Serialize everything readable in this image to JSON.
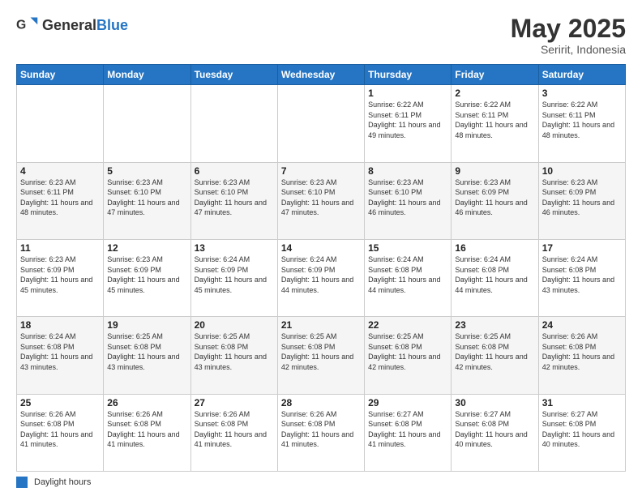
{
  "logo": {
    "general": "General",
    "blue": "Blue"
  },
  "header": {
    "title": "May 2025",
    "subtitle": "Seririt, Indonesia"
  },
  "days": [
    "Sunday",
    "Monday",
    "Tuesday",
    "Wednesday",
    "Thursday",
    "Friday",
    "Saturday"
  ],
  "weeks": [
    [
      {
        "day": "",
        "sunrise": "",
        "sunset": "",
        "daylight": ""
      },
      {
        "day": "",
        "sunrise": "",
        "sunset": "",
        "daylight": ""
      },
      {
        "day": "",
        "sunrise": "",
        "sunset": "",
        "daylight": ""
      },
      {
        "day": "",
        "sunrise": "",
        "sunset": "",
        "daylight": ""
      },
      {
        "day": "1",
        "sunrise": "Sunrise: 6:22 AM",
        "sunset": "Sunset: 6:11 PM",
        "daylight": "Daylight: 11 hours and 49 minutes."
      },
      {
        "day": "2",
        "sunrise": "Sunrise: 6:22 AM",
        "sunset": "Sunset: 6:11 PM",
        "daylight": "Daylight: 11 hours and 48 minutes."
      },
      {
        "day": "3",
        "sunrise": "Sunrise: 6:22 AM",
        "sunset": "Sunset: 6:11 PM",
        "daylight": "Daylight: 11 hours and 48 minutes."
      }
    ],
    [
      {
        "day": "4",
        "sunrise": "Sunrise: 6:23 AM",
        "sunset": "Sunset: 6:11 PM",
        "daylight": "Daylight: 11 hours and 48 minutes."
      },
      {
        "day": "5",
        "sunrise": "Sunrise: 6:23 AM",
        "sunset": "Sunset: 6:10 PM",
        "daylight": "Daylight: 11 hours and 47 minutes."
      },
      {
        "day": "6",
        "sunrise": "Sunrise: 6:23 AM",
        "sunset": "Sunset: 6:10 PM",
        "daylight": "Daylight: 11 hours and 47 minutes."
      },
      {
        "day": "7",
        "sunrise": "Sunrise: 6:23 AM",
        "sunset": "Sunset: 6:10 PM",
        "daylight": "Daylight: 11 hours and 47 minutes."
      },
      {
        "day": "8",
        "sunrise": "Sunrise: 6:23 AM",
        "sunset": "Sunset: 6:10 PM",
        "daylight": "Daylight: 11 hours and 46 minutes."
      },
      {
        "day": "9",
        "sunrise": "Sunrise: 6:23 AM",
        "sunset": "Sunset: 6:09 PM",
        "daylight": "Daylight: 11 hours and 46 minutes."
      },
      {
        "day": "10",
        "sunrise": "Sunrise: 6:23 AM",
        "sunset": "Sunset: 6:09 PM",
        "daylight": "Daylight: 11 hours and 46 minutes."
      }
    ],
    [
      {
        "day": "11",
        "sunrise": "Sunrise: 6:23 AM",
        "sunset": "Sunset: 6:09 PM",
        "daylight": "Daylight: 11 hours and 45 minutes."
      },
      {
        "day": "12",
        "sunrise": "Sunrise: 6:23 AM",
        "sunset": "Sunset: 6:09 PM",
        "daylight": "Daylight: 11 hours and 45 minutes."
      },
      {
        "day": "13",
        "sunrise": "Sunrise: 6:24 AM",
        "sunset": "Sunset: 6:09 PM",
        "daylight": "Daylight: 11 hours and 45 minutes."
      },
      {
        "day": "14",
        "sunrise": "Sunrise: 6:24 AM",
        "sunset": "Sunset: 6:09 PM",
        "daylight": "Daylight: 11 hours and 44 minutes."
      },
      {
        "day": "15",
        "sunrise": "Sunrise: 6:24 AM",
        "sunset": "Sunset: 6:08 PM",
        "daylight": "Daylight: 11 hours and 44 minutes."
      },
      {
        "day": "16",
        "sunrise": "Sunrise: 6:24 AM",
        "sunset": "Sunset: 6:08 PM",
        "daylight": "Daylight: 11 hours and 44 minutes."
      },
      {
        "day": "17",
        "sunrise": "Sunrise: 6:24 AM",
        "sunset": "Sunset: 6:08 PM",
        "daylight": "Daylight: 11 hours and 43 minutes."
      }
    ],
    [
      {
        "day": "18",
        "sunrise": "Sunrise: 6:24 AM",
        "sunset": "Sunset: 6:08 PM",
        "daylight": "Daylight: 11 hours and 43 minutes."
      },
      {
        "day": "19",
        "sunrise": "Sunrise: 6:25 AM",
        "sunset": "Sunset: 6:08 PM",
        "daylight": "Daylight: 11 hours and 43 minutes."
      },
      {
        "day": "20",
        "sunrise": "Sunrise: 6:25 AM",
        "sunset": "Sunset: 6:08 PM",
        "daylight": "Daylight: 11 hours and 43 minutes."
      },
      {
        "day": "21",
        "sunrise": "Sunrise: 6:25 AM",
        "sunset": "Sunset: 6:08 PM",
        "daylight": "Daylight: 11 hours and 42 minutes."
      },
      {
        "day": "22",
        "sunrise": "Sunrise: 6:25 AM",
        "sunset": "Sunset: 6:08 PM",
        "daylight": "Daylight: 11 hours and 42 minutes."
      },
      {
        "day": "23",
        "sunrise": "Sunrise: 6:25 AM",
        "sunset": "Sunset: 6:08 PM",
        "daylight": "Daylight: 11 hours and 42 minutes."
      },
      {
        "day": "24",
        "sunrise": "Sunrise: 6:26 AM",
        "sunset": "Sunset: 6:08 PM",
        "daylight": "Daylight: 11 hours and 42 minutes."
      }
    ],
    [
      {
        "day": "25",
        "sunrise": "Sunrise: 6:26 AM",
        "sunset": "Sunset: 6:08 PM",
        "daylight": "Daylight: 11 hours and 41 minutes."
      },
      {
        "day": "26",
        "sunrise": "Sunrise: 6:26 AM",
        "sunset": "Sunset: 6:08 PM",
        "daylight": "Daylight: 11 hours and 41 minutes."
      },
      {
        "day": "27",
        "sunrise": "Sunrise: 6:26 AM",
        "sunset": "Sunset: 6:08 PM",
        "daylight": "Daylight: 11 hours and 41 minutes."
      },
      {
        "day": "28",
        "sunrise": "Sunrise: 6:26 AM",
        "sunset": "Sunset: 6:08 PM",
        "daylight": "Daylight: 11 hours and 41 minutes."
      },
      {
        "day": "29",
        "sunrise": "Sunrise: 6:27 AM",
        "sunset": "Sunset: 6:08 PM",
        "daylight": "Daylight: 11 hours and 41 minutes."
      },
      {
        "day": "30",
        "sunrise": "Sunrise: 6:27 AM",
        "sunset": "Sunset: 6:08 PM",
        "daylight": "Daylight: 11 hours and 40 minutes."
      },
      {
        "day": "31",
        "sunrise": "Sunrise: 6:27 AM",
        "sunset": "Sunset: 6:08 PM",
        "daylight": "Daylight: 11 hours and 40 minutes."
      }
    ]
  ],
  "footer": {
    "daylight_label": "Daylight hours"
  }
}
